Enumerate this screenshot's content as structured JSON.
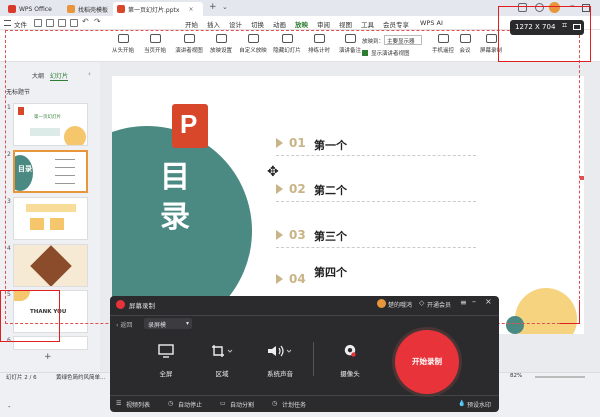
{
  "titlebar": {
    "tabs": [
      {
        "label": "WPS Office"
      },
      {
        "label": "找稻壳模板"
      },
      {
        "label": "第一页幻灯片.pptx"
      }
    ],
    "new_tab": "+"
  },
  "menubar": {
    "file": "文件",
    "items": [
      "开始",
      "插入",
      "设计",
      "切换",
      "动画",
      "放映",
      "审阅",
      "视图",
      "工具",
      "会员专享"
    ],
    "active": "放映",
    "wps_ai": "WPS AI"
  },
  "ribbon": {
    "buttons": [
      "从头开始",
      "当页开始",
      "演讲者视图",
      "放映设置",
      "自定义放映",
      "隐藏幻灯片",
      "排练计时",
      "演讲备注",
      "手机遥控",
      "会议",
      "屏幕录制"
    ],
    "display_label": "放映到：",
    "display_value": "主要显示器",
    "presenter_view_check": "显示演讲者视图"
  },
  "sidebar": {
    "tabs": [
      "大纲",
      "幻灯片"
    ],
    "section": "无标题节",
    "slide_numbers": [
      "1",
      "2",
      "3",
      "4",
      "5",
      "6"
    ],
    "thumb_texts": {
      "t1": "第一页幻灯片",
      "t2": "目录",
      "t5": "THANK YOU"
    },
    "add_button": "+"
  },
  "slide": {
    "logo_letter": "P",
    "title": "目录",
    "items": [
      {
        "num": "01",
        "label": "第一个"
      },
      {
        "num": "02",
        "label": "第二个"
      },
      {
        "num": "03",
        "label": "第三个"
      },
      {
        "num": "04",
        "label": "第四个"
      }
    ]
  },
  "size_indicator": "1272 X 704",
  "recorder": {
    "title": "屏幕录制",
    "user": "楚的哦鸿",
    "vip": "开通会员",
    "back": "返回",
    "mode": "录屏模",
    "tools": [
      "全屏",
      "区域",
      "系统声音",
      "摄像头"
    ],
    "start": "开始录制",
    "footer": [
      "视频列表",
      "自动停止",
      "自动分割",
      "计划任务"
    ],
    "watermark": "预设水印"
  },
  "status": {
    "slide_count": "幻灯片 2 / 6",
    "theme": "黄绿色简约风简单...",
    "zoom": "82%",
    "tail": "-"
  },
  "colors": {
    "accent": "#2e7d32",
    "teal": "#4a8a82",
    "orange": "#f5c66b",
    "logo": "#d9472b",
    "record": "#e8333a"
  }
}
